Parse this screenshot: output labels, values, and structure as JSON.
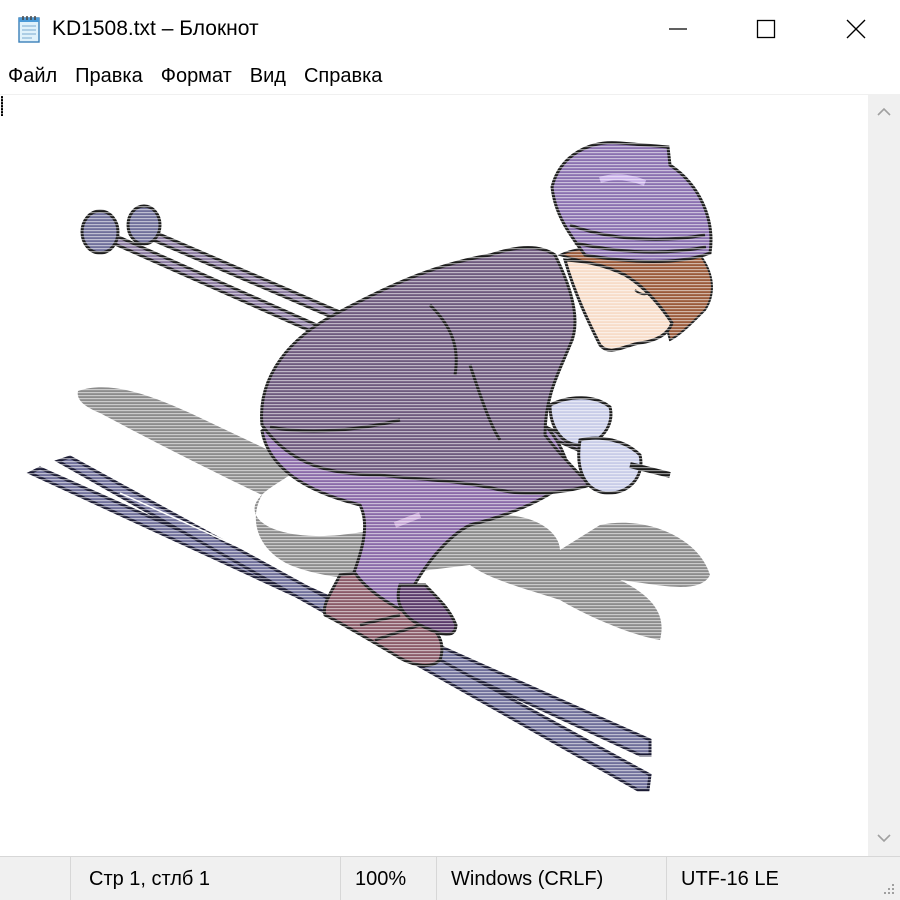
{
  "window": {
    "title": "KD1508.txt – Блокнот",
    "app_icon": "notepad-icon",
    "controls": {
      "minimize_icon": "minimize-icon",
      "maximize_icon": "maximize-icon",
      "close_icon": "close-icon"
    }
  },
  "menubar": {
    "items": [
      {
        "label": "Файл"
      },
      {
        "label": "Правка"
      },
      {
        "label": "Формат"
      },
      {
        "label": "Вид"
      },
      {
        "label": "Справка"
      }
    ]
  },
  "editor": {
    "content_picture": "ascii-art-skier"
  },
  "scrollbar": {
    "up_icon": "chevron-up-icon",
    "down_icon": "chevron-down-icon"
  },
  "statusbar": {
    "position": "Стр 1, стлб 1",
    "zoom": "100%",
    "line_ending": "Windows (CRLF)",
    "encoding": "UTF-16 LE"
  },
  "colors": {
    "jacket": "#6e5a7e",
    "pants": "#8a6aa8",
    "hat": "#8a70b0",
    "ski": "#6f6f9a",
    "shadow": "#8c8c8c",
    "skin": "#f7dcc8",
    "hair": "#9a5a3a",
    "glove": "#c8cce8",
    "boot": "#8a5a68"
  }
}
